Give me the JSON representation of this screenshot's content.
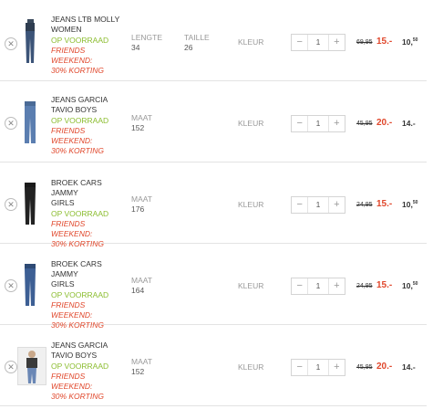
{
  "items": [
    {
      "name_lines": [
        "JEANS LTB MOLLY",
        "WOMEN"
      ],
      "stock": "OP VOORRAAD",
      "promo_lines": [
        "Friends weekend:",
        "30% korting"
      ],
      "attr1_label": "LENGTE",
      "attr1_value": "34",
      "attr2_label": "TAILLE",
      "attr2_value": "26",
      "color_label": "KLEUR",
      "qty": "1",
      "old_price": "69,95",
      "new_price": "15.-",
      "total_main": "10,",
      "total_sup": "50"
    },
    {
      "name_lines": [
        "JEANS GARCIA",
        "TAVIO BOYS"
      ],
      "stock": "OP VOORRAAD",
      "promo_lines": [
        "Friends weekend:",
        "30% korting"
      ],
      "attr1_label": "MAAT",
      "attr1_value": "152",
      "color_label": "KLEUR",
      "qty": "1",
      "old_price": "45,95",
      "new_price": "20.-",
      "total_main": "14.-",
      "total_sup": ""
    },
    {
      "name_lines": [
        "BROEK CARS JAMMY",
        "GIRLS"
      ],
      "stock": "OP VOORRAAD",
      "promo_lines": [
        "Friends weekend:",
        "30% korting"
      ],
      "attr1_label": "MAAT",
      "attr1_value": "176",
      "color_label": "KLEUR",
      "qty": "1",
      "old_price": "24,95",
      "new_price": "15.-",
      "total_main": "10,",
      "total_sup": "50"
    },
    {
      "name_lines": [
        "BROEK CARS JAMMY",
        "GIRLS"
      ],
      "stock": "OP VOORRAAD",
      "promo_lines": [
        "Friends weekend:",
        "30% korting"
      ],
      "attr1_label": "MAAT",
      "attr1_value": "164",
      "color_label": "KLEUR",
      "qty": "1",
      "old_price": "24,95",
      "new_price": "15.-",
      "total_main": "10,",
      "total_sup": "50"
    },
    {
      "name_lines": [
        "JEANS GARCIA",
        "TAVIO BOYS"
      ],
      "stock": "OP VOORRAAD",
      "promo_lines": [
        "Friends weekend:",
        "30% korting"
      ],
      "attr1_label": "MAAT",
      "attr1_value": "152",
      "color_label": "KLEUR",
      "qty": "1",
      "old_price": "45,95",
      "new_price": "20.-",
      "total_main": "14.-",
      "total_sup": ""
    }
  ],
  "icons": {
    "remove": "close-icon",
    "minus": "minus-icon",
    "plus": "plus-icon"
  },
  "colors": {
    "stock": "#8bbd2f",
    "promo": "#e0462a",
    "new_price": "#e0462a"
  }
}
